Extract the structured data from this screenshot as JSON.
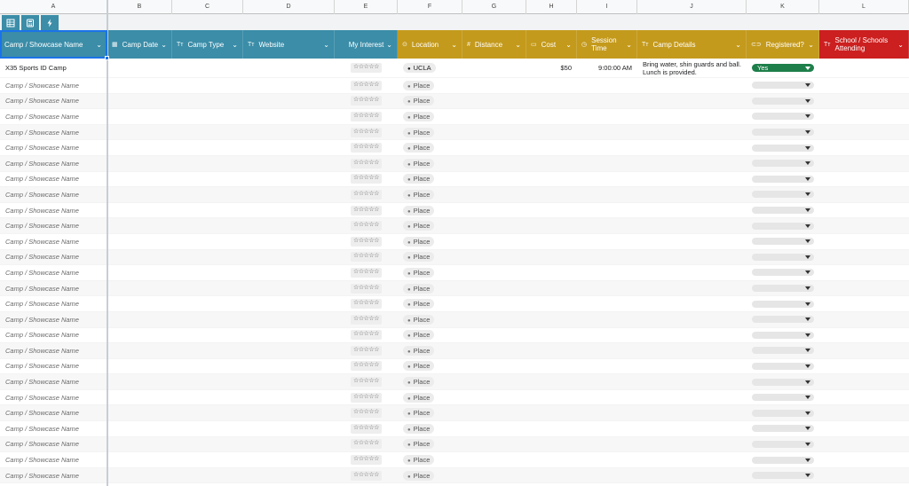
{
  "column_letters": [
    "A",
    "B",
    "C",
    "D",
    "E",
    "F",
    "G",
    "H",
    "I",
    "J",
    "K",
    "L"
  ],
  "toolbar": {
    "buttons": [
      "grid-view-icon",
      "calculator-icon",
      "lightning-icon"
    ]
  },
  "headers": [
    {
      "label": "Camp / Showcase Name",
      "icon": "",
      "color": "#3b8da8"
    },
    {
      "label": "Camp Date",
      "icon": "calendar-icon",
      "color": "#3b8da8"
    },
    {
      "label": "Camp Type",
      "icon": "text-icon",
      "color": "#3b8da8"
    },
    {
      "label": "Website",
      "icon": "text-icon",
      "color": "#3b8da8"
    },
    {
      "label": "My Interest",
      "icon": "",
      "color": "#3b8da8"
    },
    {
      "label": "Location",
      "icon": "pin-icon",
      "color": "#c49a1c"
    },
    {
      "label": "Distance",
      "icon": "hash-icon",
      "color": "#c49a1c"
    },
    {
      "label": "Cost",
      "icon": "money-icon",
      "color": "#c49a1c"
    },
    {
      "label": "Session Time",
      "icon": "clock-icon",
      "color": "#c49a1c"
    },
    {
      "label": "Camp Details",
      "icon": "text-icon",
      "color": "#c49a1c"
    },
    {
      "label": "Registered?",
      "icon": "toggle-icon",
      "color": "#c49a1c"
    },
    {
      "label": "School / Schools Attending",
      "icon": "text-icon",
      "color": "#cc1f1f"
    }
  ],
  "icon_glyphs": {
    "calendar-icon": "▦",
    "text-icon": "Tт",
    "pin-icon": "⊙",
    "hash-icon": "#",
    "money-icon": "▭",
    "clock-icon": "◷",
    "toggle-icon": "⊂⊃"
  },
  "placeholders": {
    "name": "Camp / Showcase Name",
    "location": "Place",
    "stars": "☆☆☆☆☆"
  },
  "first_row": {
    "name": "X35 Sports ID Camp",
    "stars": "☆☆☆☆☆",
    "location": "UCLA",
    "cost": "$50",
    "session_time": "9:00:00 AM",
    "details": "Bring water, shin guards and ball. Lunch is provided.",
    "registered": "Yes"
  },
  "empty_row_count": 26
}
